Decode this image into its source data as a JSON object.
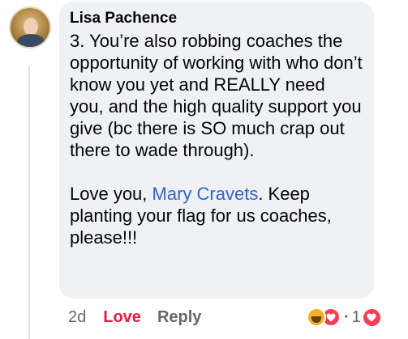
{
  "comment": {
    "author": "Lisa Pachence",
    "paragraph1": "3. You’re also robbing coaches the opportunity of working with who don’t know you yet and REALLY need you, and the high quality support you give (bc there is SO much crap out there to wade through).",
    "paragraph2_prefix": "Love you, ",
    "mention": "Mary Cravets",
    "paragraph2_suffix": ". Keep planting your flag for us coaches, please!!!"
  },
  "actions": {
    "timestamp": "2d",
    "love_label": "Love",
    "reply_label": "Reply"
  },
  "reactions": {
    "separator": "·",
    "count": "1",
    "icons": [
      "care-icon",
      "love-heart-icon"
    ]
  },
  "colors": {
    "bubble": "#eff1f4",
    "mention": "#2f66c9",
    "love": "#e41e3f",
    "meta": "#65676b"
  }
}
